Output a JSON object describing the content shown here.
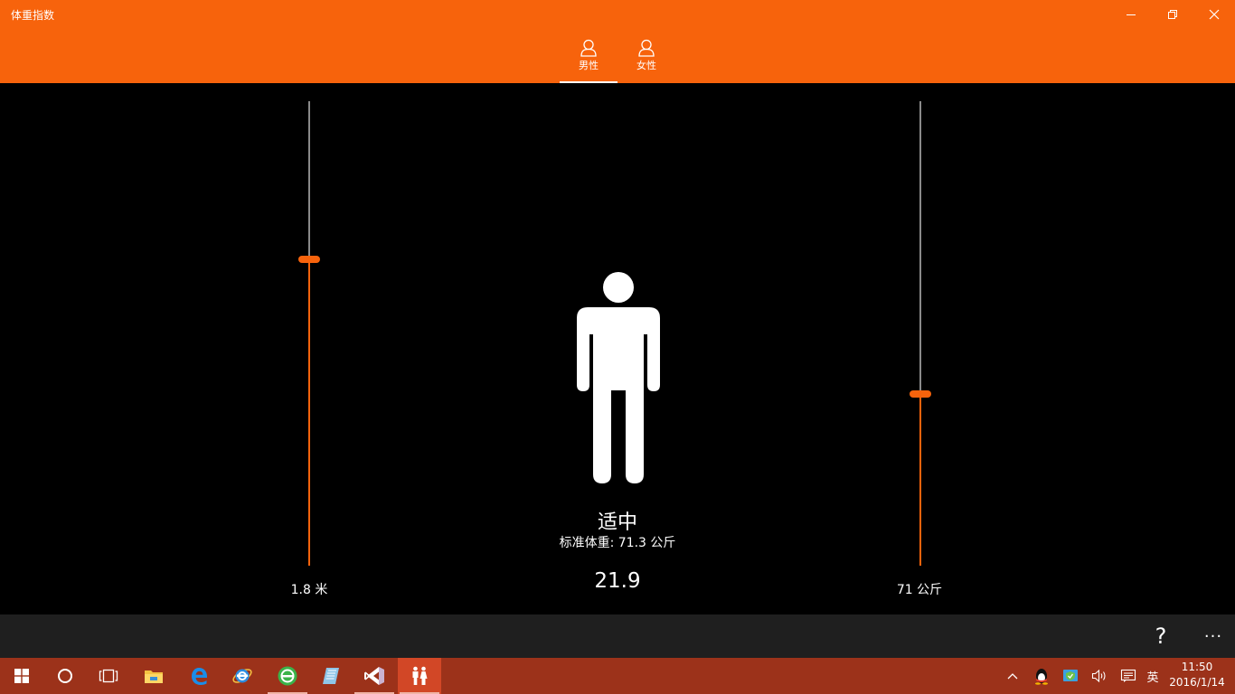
{
  "window": {
    "title": "体重指数"
  },
  "tabs": [
    {
      "label": "男性",
      "icon": "male-user-icon",
      "selected": true
    },
    {
      "label": "女性",
      "icon": "female-user-icon",
      "selected": false
    }
  ],
  "height_slider": {
    "value_label": "1.8 米",
    "level": 0.66
  },
  "weight_slider": {
    "value_label": "71 公斤",
    "level": 0.37
  },
  "result": {
    "status": "适中",
    "standard_weight": "标准体重: 71.3 公斤",
    "bmi": "21.9"
  },
  "appbar": {
    "help_label": "?",
    "more_label": "···"
  },
  "taskbar": {
    "items": [
      {
        "name": "start-icon"
      },
      {
        "name": "cortana-icon"
      },
      {
        "name": "task-view-icon"
      },
      {
        "name": "file-explorer-icon"
      },
      {
        "name": "edge-icon"
      },
      {
        "name": "internet-explorer-icon"
      },
      {
        "name": "browser-360-icon"
      },
      {
        "name": "notepad-icon"
      },
      {
        "name": "visual-studio-icon"
      },
      {
        "name": "bmi-app-icon"
      }
    ],
    "tray": {
      "ime_label": "英",
      "time": "11:50",
      "date": "2016/1/14"
    }
  },
  "colors": {
    "accent": "#F7630C",
    "taskbar": "#9C321A",
    "taskbar_active": "#D24726",
    "appbar": "#1F1F1F",
    "track": "#8A8A8A"
  }
}
